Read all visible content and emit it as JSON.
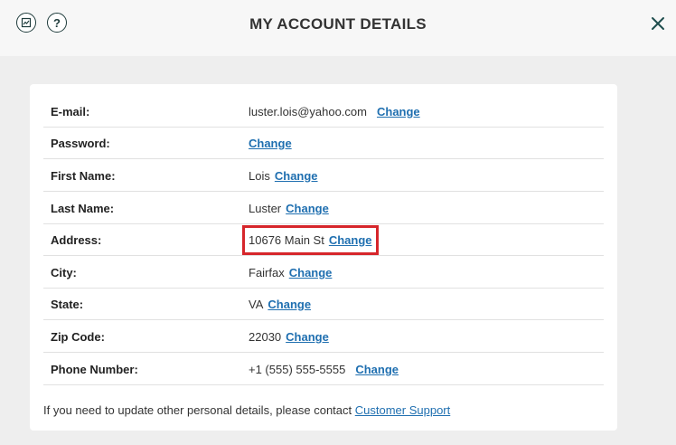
{
  "header": {
    "title": "MY ACCOUNT DETAILS",
    "left_icons": [
      "document-chart-icon",
      "help-icon"
    ],
    "help_glyph": "?",
    "close_icon": "close-icon"
  },
  "account": {
    "change_label": "Change",
    "rows": [
      {
        "label": "E-mail:",
        "value": "luster.lois@yahoo.com"
      },
      {
        "label": "Password:",
        "value": ""
      },
      {
        "label": "First Name:",
        "value": "Lois"
      },
      {
        "label": "Last Name:",
        "value": "Luster"
      },
      {
        "label": "Address:",
        "value": "10676 Main St"
      },
      {
        "label": "City:",
        "value": "Fairfax"
      },
      {
        "label": "State:",
        "value": "VA"
      },
      {
        "label": "Zip Code:",
        "value": "22030"
      },
      {
        "label": "Phone Number:",
        "value": "+1 (555) 555-5555"
      }
    ]
  },
  "footer": {
    "text": "If you need to update other personal details, please contact",
    "link": "Customer Support"
  },
  "colors": {
    "accent": "#1f6fb0",
    "highlight": "#d6262b",
    "icon": "#1e3b3b"
  }
}
